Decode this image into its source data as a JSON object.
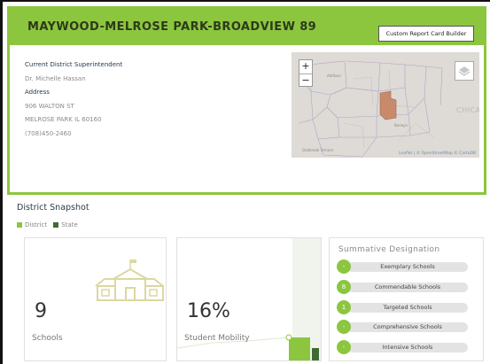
{
  "district": {
    "title": "MAYWOOD-MELROSE PARK-BROADVIEW 89",
    "report_button": "Custom Report Card Builder",
    "info": {
      "superintendent_label": "Current District Superintendent",
      "superintendent_name": "Dr. Michelle Hassan",
      "address_label": "Address",
      "street": "906 WALTON ST",
      "city_line": "MELROSE PARK IL 60160",
      "phone": "(708)450-2460"
    }
  },
  "map": {
    "zoom_in": "+",
    "zoom_out": "−",
    "city_label": "CHICAG",
    "attribution": "Leaflet | © OpenStreetMap © CartoDB"
  },
  "snapshot": {
    "title": "District Snapshot",
    "legend": [
      {
        "label": "District",
        "color": "#8cc63f"
      },
      {
        "label": "State",
        "color": "#3d6b35"
      }
    ],
    "schools": {
      "value": "9",
      "label": "Schools"
    },
    "mobility": {
      "value": "16%",
      "label": "Student Mobility"
    }
  },
  "summative": {
    "title": "Summative Designation",
    "rows": [
      {
        "count": "-",
        "label": "Exemplary Schools"
      },
      {
        "count": "8",
        "label": "Commendable Schools"
      },
      {
        "count": "1",
        "label": "Targeted Schools"
      },
      {
        "count": "-",
        "label": "Comprehensive Schools"
      },
      {
        "count": "-",
        "label": "Intensive Schools"
      }
    ]
  },
  "colors": {
    "accent": "#8cc63f",
    "state": "#3d6b35",
    "highlight": "#c98a6c"
  }
}
